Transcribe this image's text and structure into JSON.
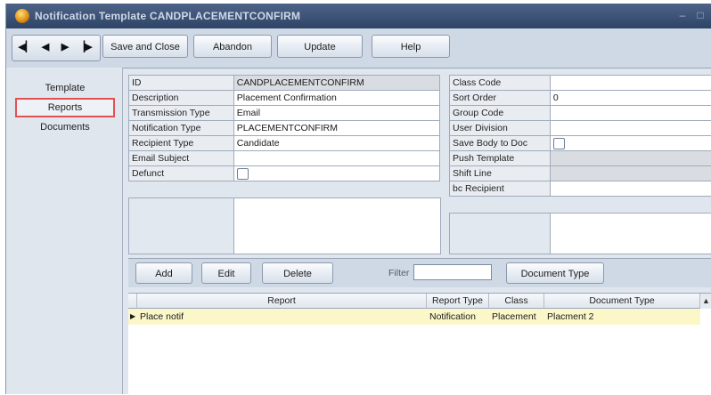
{
  "window": {
    "title": "Notification Template CANDPLACEMENTCONFIRM"
  },
  "toolbar": {
    "nav_icons": [
      "first-record-icon",
      "previous-record-icon",
      "next-record-icon",
      "last-record-icon"
    ],
    "save_close": "Save and Close",
    "abandon": "Abandon",
    "update": "Update",
    "help": "Help"
  },
  "sidebar": {
    "items": [
      {
        "label": "Template",
        "selected": false
      },
      {
        "label": "Reports",
        "selected": true
      },
      {
        "label": "Documents",
        "selected": false
      }
    ]
  },
  "form_left": {
    "id_label": "ID",
    "id_value": "CANDPLACEMENTCONFIRM",
    "description_label": "Description",
    "description_value": "Placement Confirmation",
    "transmission_label": "Transmission Type",
    "transmission_value": "Email",
    "notification_label": "Notification Type",
    "notification_value": "PLACEMENTCONFIRM",
    "recipient_label": "Recipient Type",
    "recipient_value": "Candidate",
    "email_subject_label": "Email Subject",
    "email_subject_value": "",
    "defunct_label": "Defunct",
    "defunct_checked": false
  },
  "form_right": {
    "class_code_label": "Class Code",
    "class_code_value": "",
    "sort_order_label": "Sort Order",
    "sort_order_value": "0",
    "group_code_label": "Group Code",
    "group_code_value": "",
    "user_division_label": "User Division",
    "user_division_value": "",
    "save_body_label": "Save Body to Doc",
    "save_body_checked": false,
    "push_template_label": "Push Template",
    "push_template_value": "",
    "shift_line_label": "Shift Line",
    "shift_line_value": "",
    "bc_recipient_label": "bc Recipient",
    "bc_recipient_value": ""
  },
  "reports_toolbar": {
    "add": "Add",
    "edit": "Edit",
    "delete": "Delete",
    "filter_label": "Filter",
    "filter_value": "",
    "document_type": "Document Type"
  },
  "reports_table": {
    "columns": [
      "Report",
      "Report Type",
      "Class",
      "Document Type"
    ],
    "rows": [
      {
        "report": "Place notif",
        "report_type": "Notification",
        "class": "Placement",
        "document_type": "Placment 2"
      }
    ]
  },
  "colors": {
    "selection_highlight": "#e05252",
    "selected_row": "#fbf7c9",
    "title_bar": "#3a5276"
  }
}
